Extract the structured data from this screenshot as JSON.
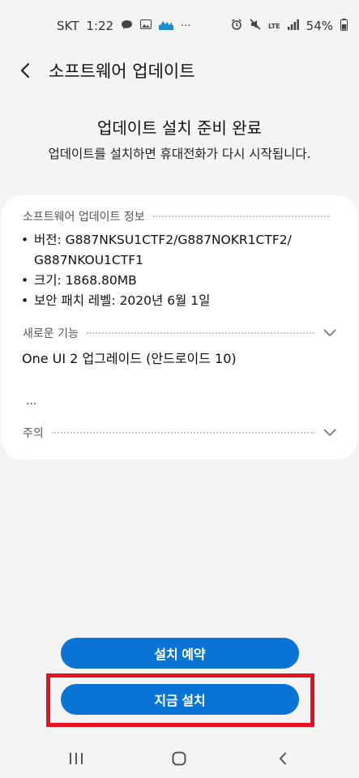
{
  "status_bar": {
    "carrier": "SKT",
    "time": "1:22",
    "ellipsis": "···",
    "network": "LTE",
    "battery": "54%"
  },
  "header": {
    "title": "소프트웨어 업데이트"
  },
  "hero": {
    "title": "업데이트 설치 준비 완료",
    "subtitle": "업데이트를 설치하면 휴대전화가 다시 시작됩니다."
  },
  "card": {
    "info_heading": "소프트웨어 업데이트 정보",
    "info_items": [
      {
        "bullet": "•",
        "text": "버전: G887NKSU1CTF2/G887NOKR1CTF2/ G887NKOU1CTF1"
      },
      {
        "bullet": "•",
        "text": "크기: 1868.80MB"
      },
      {
        "bullet": "•",
        "text": "보안 패치 레벨: 2020년 6월 1일"
      }
    ],
    "features_heading": "새로운 기능",
    "features_text": "One UI 2 업그레이드 (안드로이드 10)",
    "ellipsis": "...",
    "caution_heading": "주의"
  },
  "actions": {
    "schedule_label": "설치 예약",
    "install_now_label": "지금 설치"
  },
  "colors": {
    "accent": "#0a74d6",
    "highlight": "#e8101a",
    "background": "#f4f4f4"
  }
}
